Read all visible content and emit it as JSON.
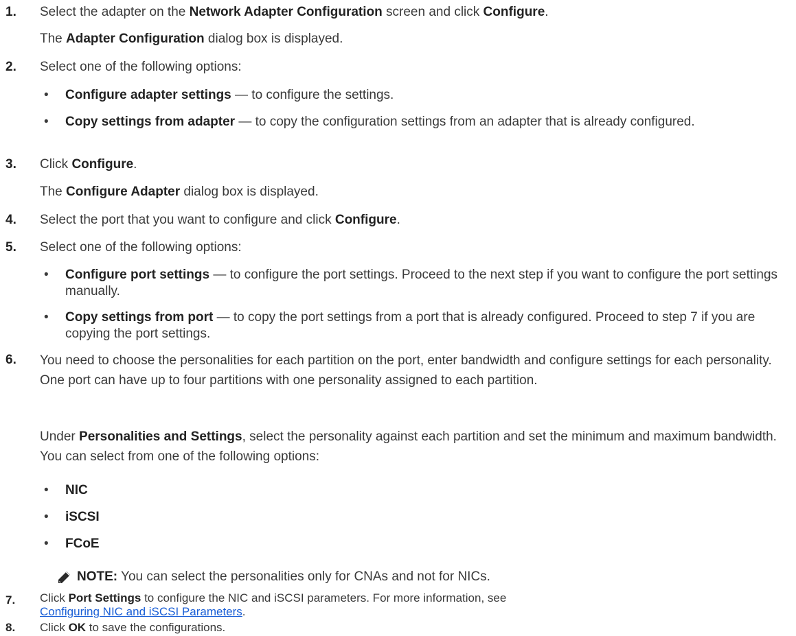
{
  "steps": [
    {
      "num": "1.",
      "pre": "Select the adapter on the ",
      "b1": "Network Adapter Configuration",
      "mid": " screen and click ",
      "b2": "Configure",
      "post": "."
    },
    {
      "sub_pre": "The ",
      "sub_b": "Adapter Configuration",
      "sub_post": " dialog box is displayed."
    },
    {
      "num": "2.",
      "text": "Select one of the following options:"
    },
    {
      "num": "3.",
      "pre": "Click ",
      "b": "Configure",
      "post": "."
    },
    {
      "sub_pre": "The ",
      "sub_b": "Configure Adapter",
      "sub_post": " dialog box is displayed."
    },
    {
      "num": "4.",
      "pre": "Select the port that you want to configure and click ",
      "b": "Configure",
      "post": "."
    },
    {
      "num": "5.",
      "text": "Select one of the following options:"
    },
    {
      "num": "6.",
      "text": "You need to choose the personalities for each partition on the port, enter bandwidth and configure settings for each personality. One port can have up to four partitions with one personality assigned to each partition."
    },
    {
      "num": "7.",
      "pre": "Click ",
      "b": "Port Settings",
      "post": " to configure the NIC and iSCSI parameters. For more information, see",
      "link": "Configuring NIC and iSCSI Parameters",
      "post2": "."
    },
    {
      "num": "8.",
      "pre": "Click ",
      "b": "OK",
      "post": " to save the configurations."
    }
  ],
  "step2_options": [
    {
      "b": "Configure adapter settings",
      "text": " — to configure the settings."
    },
    {
      "b": "Copy settings from adapter",
      "text": " — to copy the configuration settings from an adapter that is already configured."
    }
  ],
  "step5_options": [
    {
      "b": "Configure port settings",
      "text": " — to configure the port settings. Proceed to the next step if you want to configure the port settings manually."
    },
    {
      "b": "Copy settings from port",
      "text": " — to copy the port settings from a port that is already configured. Proceed to step 7 if you are copying the port settings."
    }
  ],
  "step6_para": {
    "pre": "Under ",
    "b": "Personalities and Settings",
    "post": ", select the personality against each partition and set the minimum and maximum bandwidth. You can select from one of the following options:"
  },
  "personalities": [
    "NIC",
    "iSCSI",
    "FCoE"
  ],
  "note": {
    "label": "NOTE:",
    "text": " You can select the personalities only for CNAs and not for NICs."
  },
  "icons": {
    "note": "pencil-note-icon"
  },
  "colors": {
    "link": "#1a5fd6",
    "text": "#3a3a3a"
  }
}
